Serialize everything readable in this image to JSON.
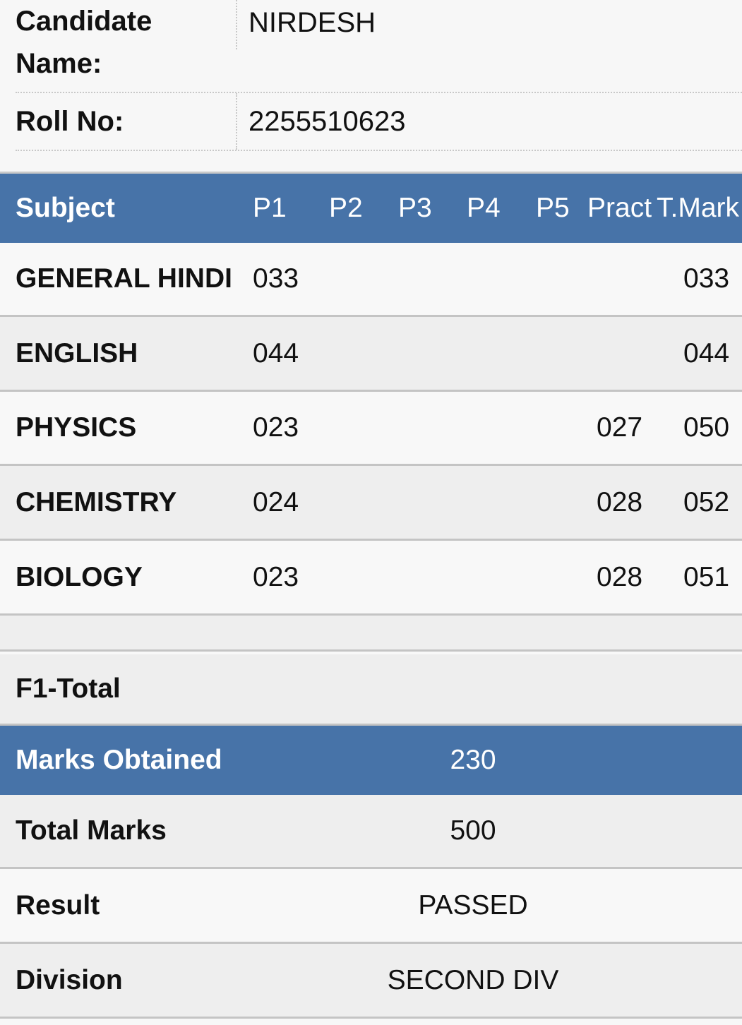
{
  "candidate": {
    "name_label": "Candidate Name:",
    "name_value": "NIRDESH",
    "roll_label": "Roll No:",
    "roll_value": "2255510623"
  },
  "table": {
    "headers": {
      "subject": "Subject",
      "p1": "P1",
      "p2": "P2",
      "p3": "P3",
      "p4": "P4",
      "p5": "P5",
      "pract": "Pract",
      "tmark": "T.Mark"
    },
    "rows": [
      {
        "subject": "GENERAL HINDI",
        "p1": "033",
        "pract": "",
        "tmark": "033"
      },
      {
        "subject": "ENGLISH",
        "p1": "044",
        "pract": "",
        "tmark": "044"
      },
      {
        "subject": "PHYSICS",
        "p1": "023",
        "pract": "027",
        "tmark": "050"
      },
      {
        "subject": "CHEMISTRY",
        "p1": "024",
        "pract": "028",
        "tmark": "052"
      },
      {
        "subject": "BIOLOGY",
        "p1": "023",
        "pract": "028",
        "tmark": "051"
      }
    ]
  },
  "summary": {
    "f1_total_label": "F1-Total",
    "marks_obtained_label": "Marks Obtained",
    "marks_obtained_value": "230",
    "total_marks_label": "Total Marks",
    "total_marks_value": "500",
    "result_label": "Result",
    "result_value": "PASSED",
    "division_label": "Division",
    "division_value": "SECOND DIV"
  },
  "colors": {
    "header_blue": "#4773a8",
    "row_light": "#f8f8f8",
    "row_grey": "#eeeeee"
  }
}
